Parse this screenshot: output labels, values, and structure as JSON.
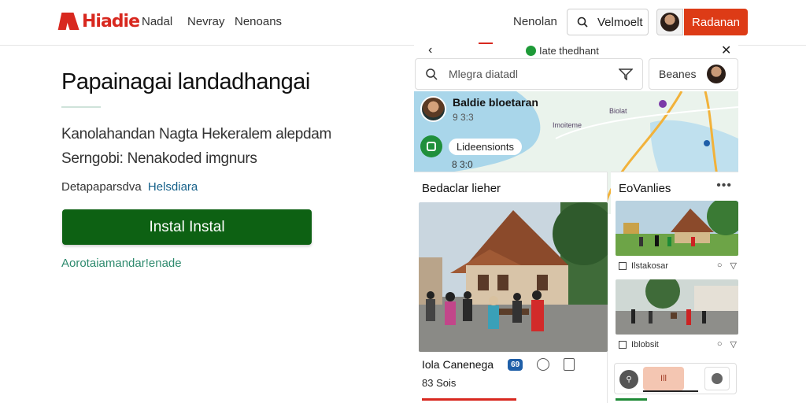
{
  "brand": {
    "name": "Hiadie",
    "color": "#d8281f"
  },
  "nav": {
    "links": [
      "Nadal",
      "Nevray",
      "Nenoans"
    ],
    "right_link": "Nenolan",
    "search_label": "Velmoelt",
    "cta_label": "Radanan"
  },
  "hero": {
    "title": "Papainagai landadhangai",
    "desc_line1": "Kanolahandan Nagta Hekeralem alepdam",
    "desc_line2": "Serngobi: Nenakoded imgnurs",
    "meta_label": "Detapaparsdva",
    "meta_link": "Helsdiara",
    "install_label": "Instal Instal",
    "sub_link": "Aorotaiamandar!enade"
  },
  "app": {
    "header_title": "Iate thedhant",
    "search_placeholder": "Mlegra diatadl",
    "user_label": "Beanes",
    "place1": {
      "name": "Baldie bloetaran",
      "sub": "9 3:3"
    },
    "place2": {
      "name": "Lideensionts",
      "sub": "8 3:0"
    },
    "map_labels": [
      "Biolat",
      "Imoiteme"
    ],
    "feed_left": {
      "title": "Bedaclar lieher",
      "caption": "Iola Canenega",
      "badge": "69",
      "count": "83 Sois"
    },
    "feed_right": {
      "title": "EoVanlies",
      "thumb1_caption": "Ilstakosar",
      "thumb2_caption": "Iblobsit",
      "more": "•••"
    },
    "bottom": {
      "mid_label": "Ill"
    }
  },
  "colors": {
    "install": "#0d6113",
    "cta": "#dd3b16",
    "link": "#16618a",
    "sublink": "#2e8a6e"
  },
  "icons": [
    "search-icon",
    "filter-icon",
    "close-icon",
    "back-icon",
    "location-pin-icon",
    "comment-icon",
    "bookmark-icon",
    "heart-icon",
    "more-icon"
  ]
}
